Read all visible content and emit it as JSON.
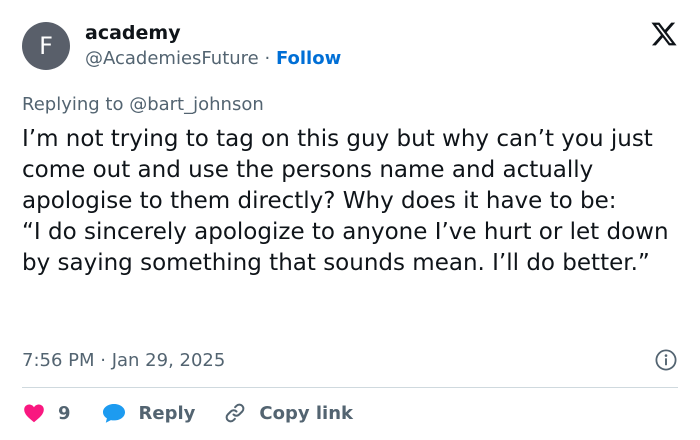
{
  "author": {
    "avatar_letter": "F",
    "display_name": "academy",
    "handle": "@AcademiesFuture",
    "separator": "·",
    "follow_label": "Follow"
  },
  "reply_to": "Replying to @bart_johnson",
  "body": {
    "paragraph_1": "I’m not trying to tag on this guy but why can’t you just come out and use the persons name and actually apologise to them directly? Why does it have to be:",
    "paragraph_2": "“I do sincerely apologize to anyone I’ve hurt or let down by saying something that sounds mean. I’ll do better.”"
  },
  "timestamp": "7:56 PM · Jan 29, 2025",
  "actions": {
    "like_count": "9",
    "reply_label": "Reply",
    "copy_link_label": "Copy link"
  },
  "icons": {
    "brand": "x-logo-icon",
    "info": "info-icon",
    "like": "heart-icon",
    "reply": "speech-bubble-icon",
    "copy": "link-icon"
  },
  "colors": {
    "text": "#0f1419",
    "secondary": "#536471",
    "follow": "#006fd6",
    "like": "#f91880",
    "reply": "#1d9bf0",
    "avatar": "#595f6a",
    "divider": "#cfd9de"
  }
}
